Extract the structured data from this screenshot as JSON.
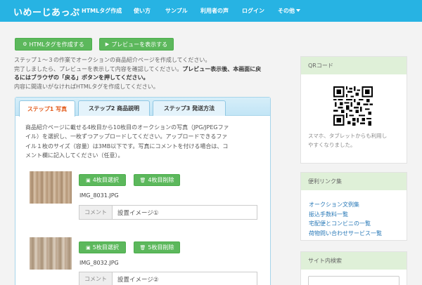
{
  "navbar": {
    "brand": "いめーじあっぷ",
    "items": [
      "HTMLタグ作成",
      "使い方",
      "サンプル",
      "利用者の声",
      "ログイン",
      "その他"
    ]
  },
  "actions": {
    "create_html": "HTMLタグを作成する",
    "preview": "プレビューを表示する"
  },
  "intro": {
    "line1": "ステップ１～３の作業でオークションの商品紹介ページを作成してください。",
    "line2_prefix": "完了しましたら、プレビューを表示して内容を確認してください。",
    "line2_bold": "プレビュー表示後、本画面に戻",
    "line3_bold": "るにはブラウザの「戻る」ボタンを押してください。",
    "line4": "内容に間違いがなければHTMLタグを作成してください。"
  },
  "tabs": [
    "ステップ1 写真",
    "ステップ2 商品説明",
    "ステップ3 発送方法"
  ],
  "step1": {
    "desc_lines": [
      "商品紹介ページに載せる4枚目から10枚目のオークションの写真（JPG/JPEGファ",
      "イル）を選択し、一枚ずつアップロードしてください。アップロードできるファ",
      "イル１枚のサイズ（容量）は3MB以下です。写真にコメントを付ける場合は、コ",
      "メント欄に記入してください（任意）。"
    ],
    "photos": [
      {
        "select": "4枚目選択",
        "delete": "4枚目削除",
        "filename": "IMG_8031.JPG",
        "comment_label": "コメント",
        "comment": "設置イメージ①"
      },
      {
        "select": "5枚目選択",
        "delete": "5枚目削除",
        "filename": "IMG_8032.JPG",
        "comment_label": "コメント",
        "comment": "設置イメージ②"
      }
    ]
  },
  "sidebar": {
    "qr": {
      "title": "QRコード",
      "text1": "スマホ、タブレットからも利用し",
      "text2": "やすくなりました。"
    },
    "links": {
      "title": "便利リンク集",
      "items": [
        "オークション文例集",
        "振込手数料一覧",
        "宅配便とコンビニの一覧",
        "荷物問い合わせサービス一覧"
      ]
    },
    "search": {
      "title": "サイト内検索"
    }
  },
  "colors": {
    "nav": "#27b3e3",
    "button": "#5cb85c",
    "active_tab": "#e35d1e",
    "link": "#2a7ab8",
    "sidebar_head": "#dff0d8"
  },
  "icons": {
    "create_html": "gear-icon",
    "preview": "play-icon",
    "select": "floppy-icon",
    "delete": "trash-icon"
  }
}
